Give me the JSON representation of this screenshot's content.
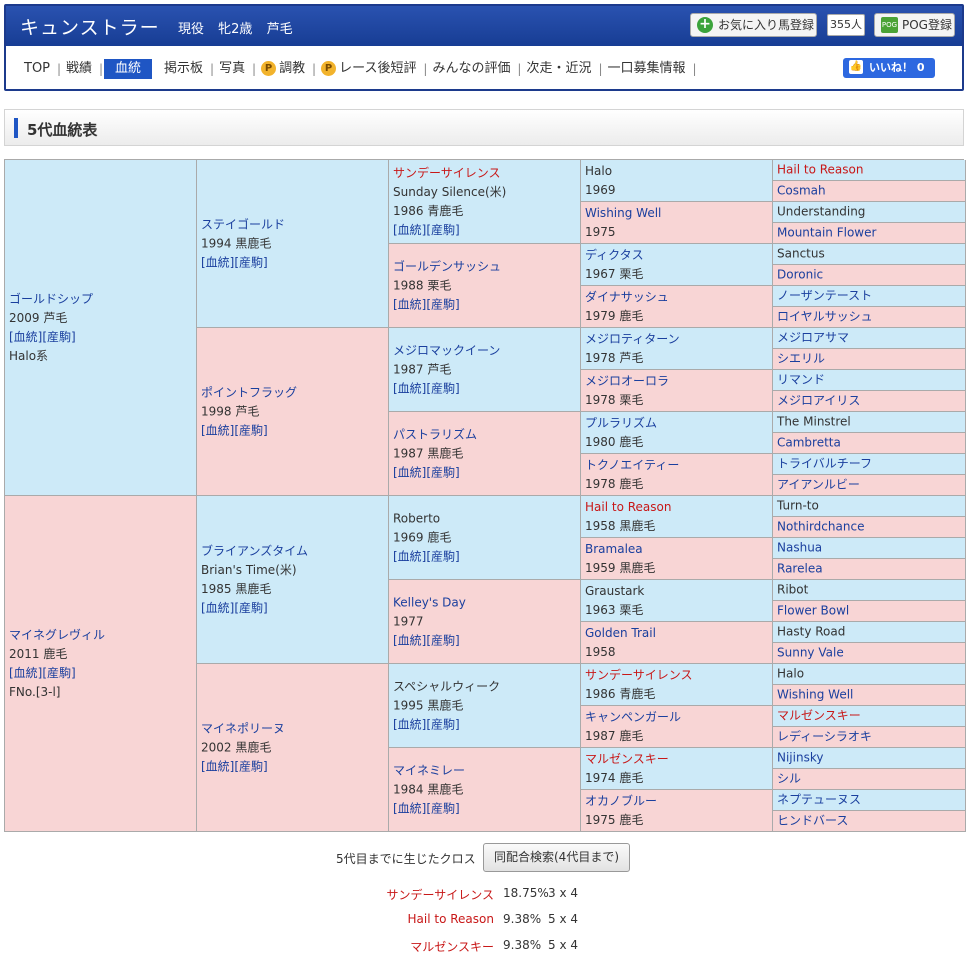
{
  "header": {
    "horse_name": "キュンストラー",
    "status": "現役",
    "sex_age": "牝2歳",
    "coat": "芦毛",
    "favorite_label": "お気に入り馬登録",
    "favorite_count": "355人",
    "pog_label": "POG登録",
    "pog_icon_text": "POG",
    "like_label": "いいね！ 0"
  },
  "nav": {
    "items": [
      "TOP",
      "戦績",
      "血統",
      "掲示板",
      "写真",
      "調教",
      "レース後短評",
      "みんなの評価",
      "次走・近況",
      "一口募集情報"
    ],
    "p_badge": "P"
  },
  "section": {
    "title": "5代血統表"
  },
  "links_text": "[血統][産駒]",
  "pedigree": {
    "g1": [
      {
        "name": "ゴールドシップ",
        "lines": [
          "2009 芦毛"
        ],
        "links": true,
        "extra": "Halo系"
      },
      {
        "name": "マイネグレヴィル",
        "lines": [
          "2011 鹿毛"
        ],
        "links": true,
        "extra": "FNo.[3-l]"
      }
    ],
    "g2": [
      {
        "name": "ステイゴールド",
        "lines": [
          "1994 黒鹿毛"
        ],
        "links": true
      },
      {
        "name": "ポイントフラッグ",
        "lines": [
          "1998 芦毛"
        ],
        "links": true
      },
      {
        "name": "ブライアンズタイム",
        "lines": [
          "Brian's Time(米)",
          "1985 黒鹿毛"
        ],
        "links": true
      },
      {
        "name": "マイネポリーヌ",
        "lines": [
          "2002 黒鹿毛"
        ],
        "links": true
      }
    ],
    "g3": [
      {
        "name": "サンデーサイレンス",
        "red": true,
        "lines": [
          "Sunday Silence(米)",
          "1986 青鹿毛"
        ],
        "links": true
      },
      {
        "name": "ゴールデンサッシュ",
        "lines": [
          "1988 栗毛"
        ],
        "links": true
      },
      {
        "name": "メジロマックイーン",
        "lines": [
          "1987 芦毛"
        ],
        "links": true
      },
      {
        "name": "パストラリズム",
        "lines": [
          "1987 黒鹿毛"
        ],
        "links": true
      },
      {
        "name": "Roberto",
        "plain": true,
        "lines": [
          "1969 鹿毛"
        ],
        "links": true
      },
      {
        "name": "Kelley's Day",
        "lines": [
          "1977"
        ],
        "links": true
      },
      {
        "name": "スペシャルウィーク",
        "plain": true,
        "lines": [
          "1995 黒鹿毛"
        ],
        "links": true
      },
      {
        "name": "マイネミレー",
        "lines": [
          "1984 黒鹿毛"
        ],
        "links": true
      }
    ],
    "g4": [
      {
        "name": "Halo",
        "plain": true,
        "lines": [
          "1969"
        ]
      },
      {
        "name": "Wishing Well",
        "lines": [
          "1975"
        ]
      },
      {
        "name": "ディクタス",
        "lines": [
          "1967 栗毛"
        ]
      },
      {
        "name": "ダイナサッシュ",
        "lines": [
          "1979 鹿毛"
        ]
      },
      {
        "name": "メジロティターン",
        "lines": [
          "1978 芦毛"
        ]
      },
      {
        "name": "メジロオーロラ",
        "lines": [
          "1978 栗毛"
        ]
      },
      {
        "name": "プルラリズム",
        "lines": [
          "1980 鹿毛"
        ]
      },
      {
        "name": "トクノエイティー",
        "lines": [
          "1978 鹿毛"
        ]
      },
      {
        "name": "Hail to Reason",
        "red": true,
        "lines": [
          "1958 黒鹿毛"
        ]
      },
      {
        "name": "Bramalea",
        "lines": [
          "1959 黒鹿毛"
        ]
      },
      {
        "name": "Graustark",
        "plain": true,
        "lines": [
          "1963 栗毛"
        ]
      },
      {
        "name": "Golden Trail",
        "lines": [
          "1958"
        ]
      },
      {
        "name": "サンデーサイレンス",
        "red": true,
        "lines": [
          "1986 青鹿毛"
        ]
      },
      {
        "name": "キャンペンガール",
        "lines": [
          "1987 鹿毛"
        ]
      },
      {
        "name": "マルゼンスキー",
        "red": true,
        "lines": [
          "1974 鹿毛"
        ]
      },
      {
        "name": "オカノブルー",
        "lines": [
          "1975 鹿毛"
        ]
      }
    ],
    "g5": [
      {
        "name": "Hail to Reason",
        "red": true
      },
      {
        "name": "Cosmah"
      },
      {
        "name": "Understanding",
        "plain": true
      },
      {
        "name": "Mountain Flower"
      },
      {
        "name": "Sanctus",
        "plain": true
      },
      {
        "name": "Doronic"
      },
      {
        "name": "ノーザンテースト"
      },
      {
        "name": "ロイヤルサッシュ"
      },
      {
        "name": "メジロアサマ"
      },
      {
        "name": "シエリル"
      },
      {
        "name": "リマンド"
      },
      {
        "name": "メジロアイリス"
      },
      {
        "name": "The Minstrel",
        "plain": true
      },
      {
        "name": "Cambretta"
      },
      {
        "name": "トライバルチーフ"
      },
      {
        "name": "アイアンルビー"
      },
      {
        "name": "Turn-to",
        "plain": true
      },
      {
        "name": "Nothirdchance"
      },
      {
        "name": "Nashua"
      },
      {
        "name": "Rarelea"
      },
      {
        "name": "Ribot",
        "plain": true
      },
      {
        "name": "Flower Bowl"
      },
      {
        "name": "Hasty Road",
        "plain": true
      },
      {
        "name": "Sunny Vale"
      },
      {
        "name": "Halo",
        "plain": true
      },
      {
        "name": "Wishing Well"
      },
      {
        "name": "マルゼンスキー",
        "red": true
      },
      {
        "name": "レディーシラオキ"
      },
      {
        "name": "Nijinsky"
      },
      {
        "name": "シル"
      },
      {
        "name": "ネプテューヌス"
      },
      {
        "name": "ヒンドバース"
      }
    ]
  },
  "cross": {
    "label": "5代目までに生じたクロス",
    "button": "同配合検索(4代目まで)",
    "rows": [
      {
        "name": "サンデーサイレンス",
        "percent": "18.75%",
        "gen": "3 x 4"
      },
      {
        "name": "Hail to Reason",
        "percent": "9.38%",
        "gen": "5 x 4"
      },
      {
        "name": "マルゼンスキー",
        "percent": "9.38%",
        "gen": "5 x 4"
      }
    ]
  }
}
